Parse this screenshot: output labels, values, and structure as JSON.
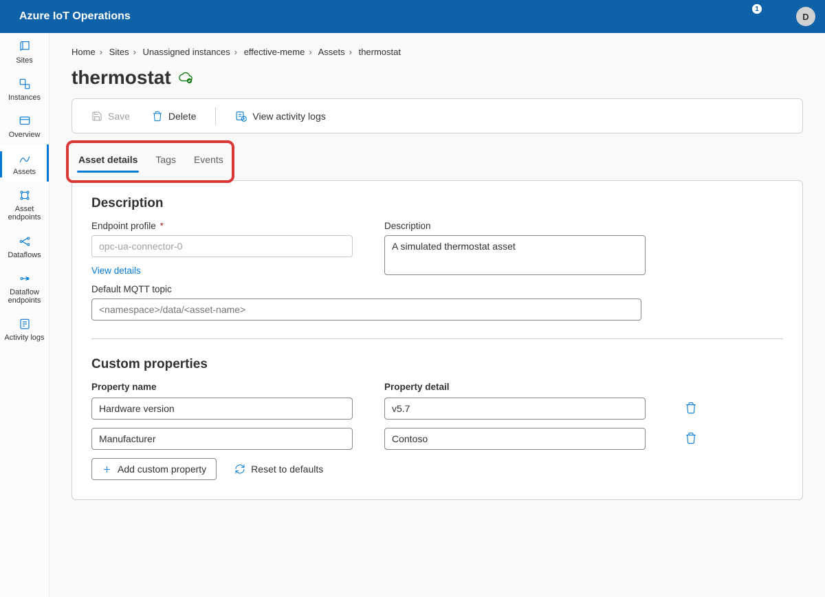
{
  "header": {
    "title": "Azure IoT Operations",
    "notifications_count": "1",
    "avatar_initial": "D"
  },
  "sidebar": {
    "items": [
      {
        "label": "Sites"
      },
      {
        "label": "Instances"
      },
      {
        "label": "Overview"
      },
      {
        "label": "Assets"
      },
      {
        "label": "Asset endpoints"
      },
      {
        "label": "Dataflows"
      },
      {
        "label": "Dataflow endpoints"
      },
      {
        "label": "Activity logs"
      }
    ],
    "active_index": 3
  },
  "breadcrumb": [
    "Home",
    "Sites",
    "Unassigned instances",
    "effective-meme",
    "Assets",
    "thermostat"
  ],
  "page_title": "thermostat",
  "actions": {
    "save": "Save",
    "delete": "Delete",
    "view_logs": "View activity logs"
  },
  "tabs": [
    {
      "label": "Asset details"
    },
    {
      "label": "Tags"
    },
    {
      "label": "Events"
    }
  ],
  "active_tab": 0,
  "description_section": {
    "heading": "Description",
    "endpoint_label": "Endpoint profile",
    "endpoint_value": "opc-ua-connector-0",
    "view_details": "View details",
    "desc_label": "Description",
    "desc_value": "A simulated thermostat asset",
    "mqtt_label": "Default MQTT topic",
    "mqtt_placeholder": "<namespace>/data/<asset-name>"
  },
  "custom_props": {
    "heading": "Custom properties",
    "col_name": "Property name",
    "col_detail": "Property detail",
    "rows": [
      {
        "name": "Hardware version",
        "detail": "v5.7"
      },
      {
        "name": "Manufacturer",
        "detail": "Contoso"
      }
    ],
    "add_label": "Add custom property",
    "reset_label": "Reset to defaults"
  }
}
